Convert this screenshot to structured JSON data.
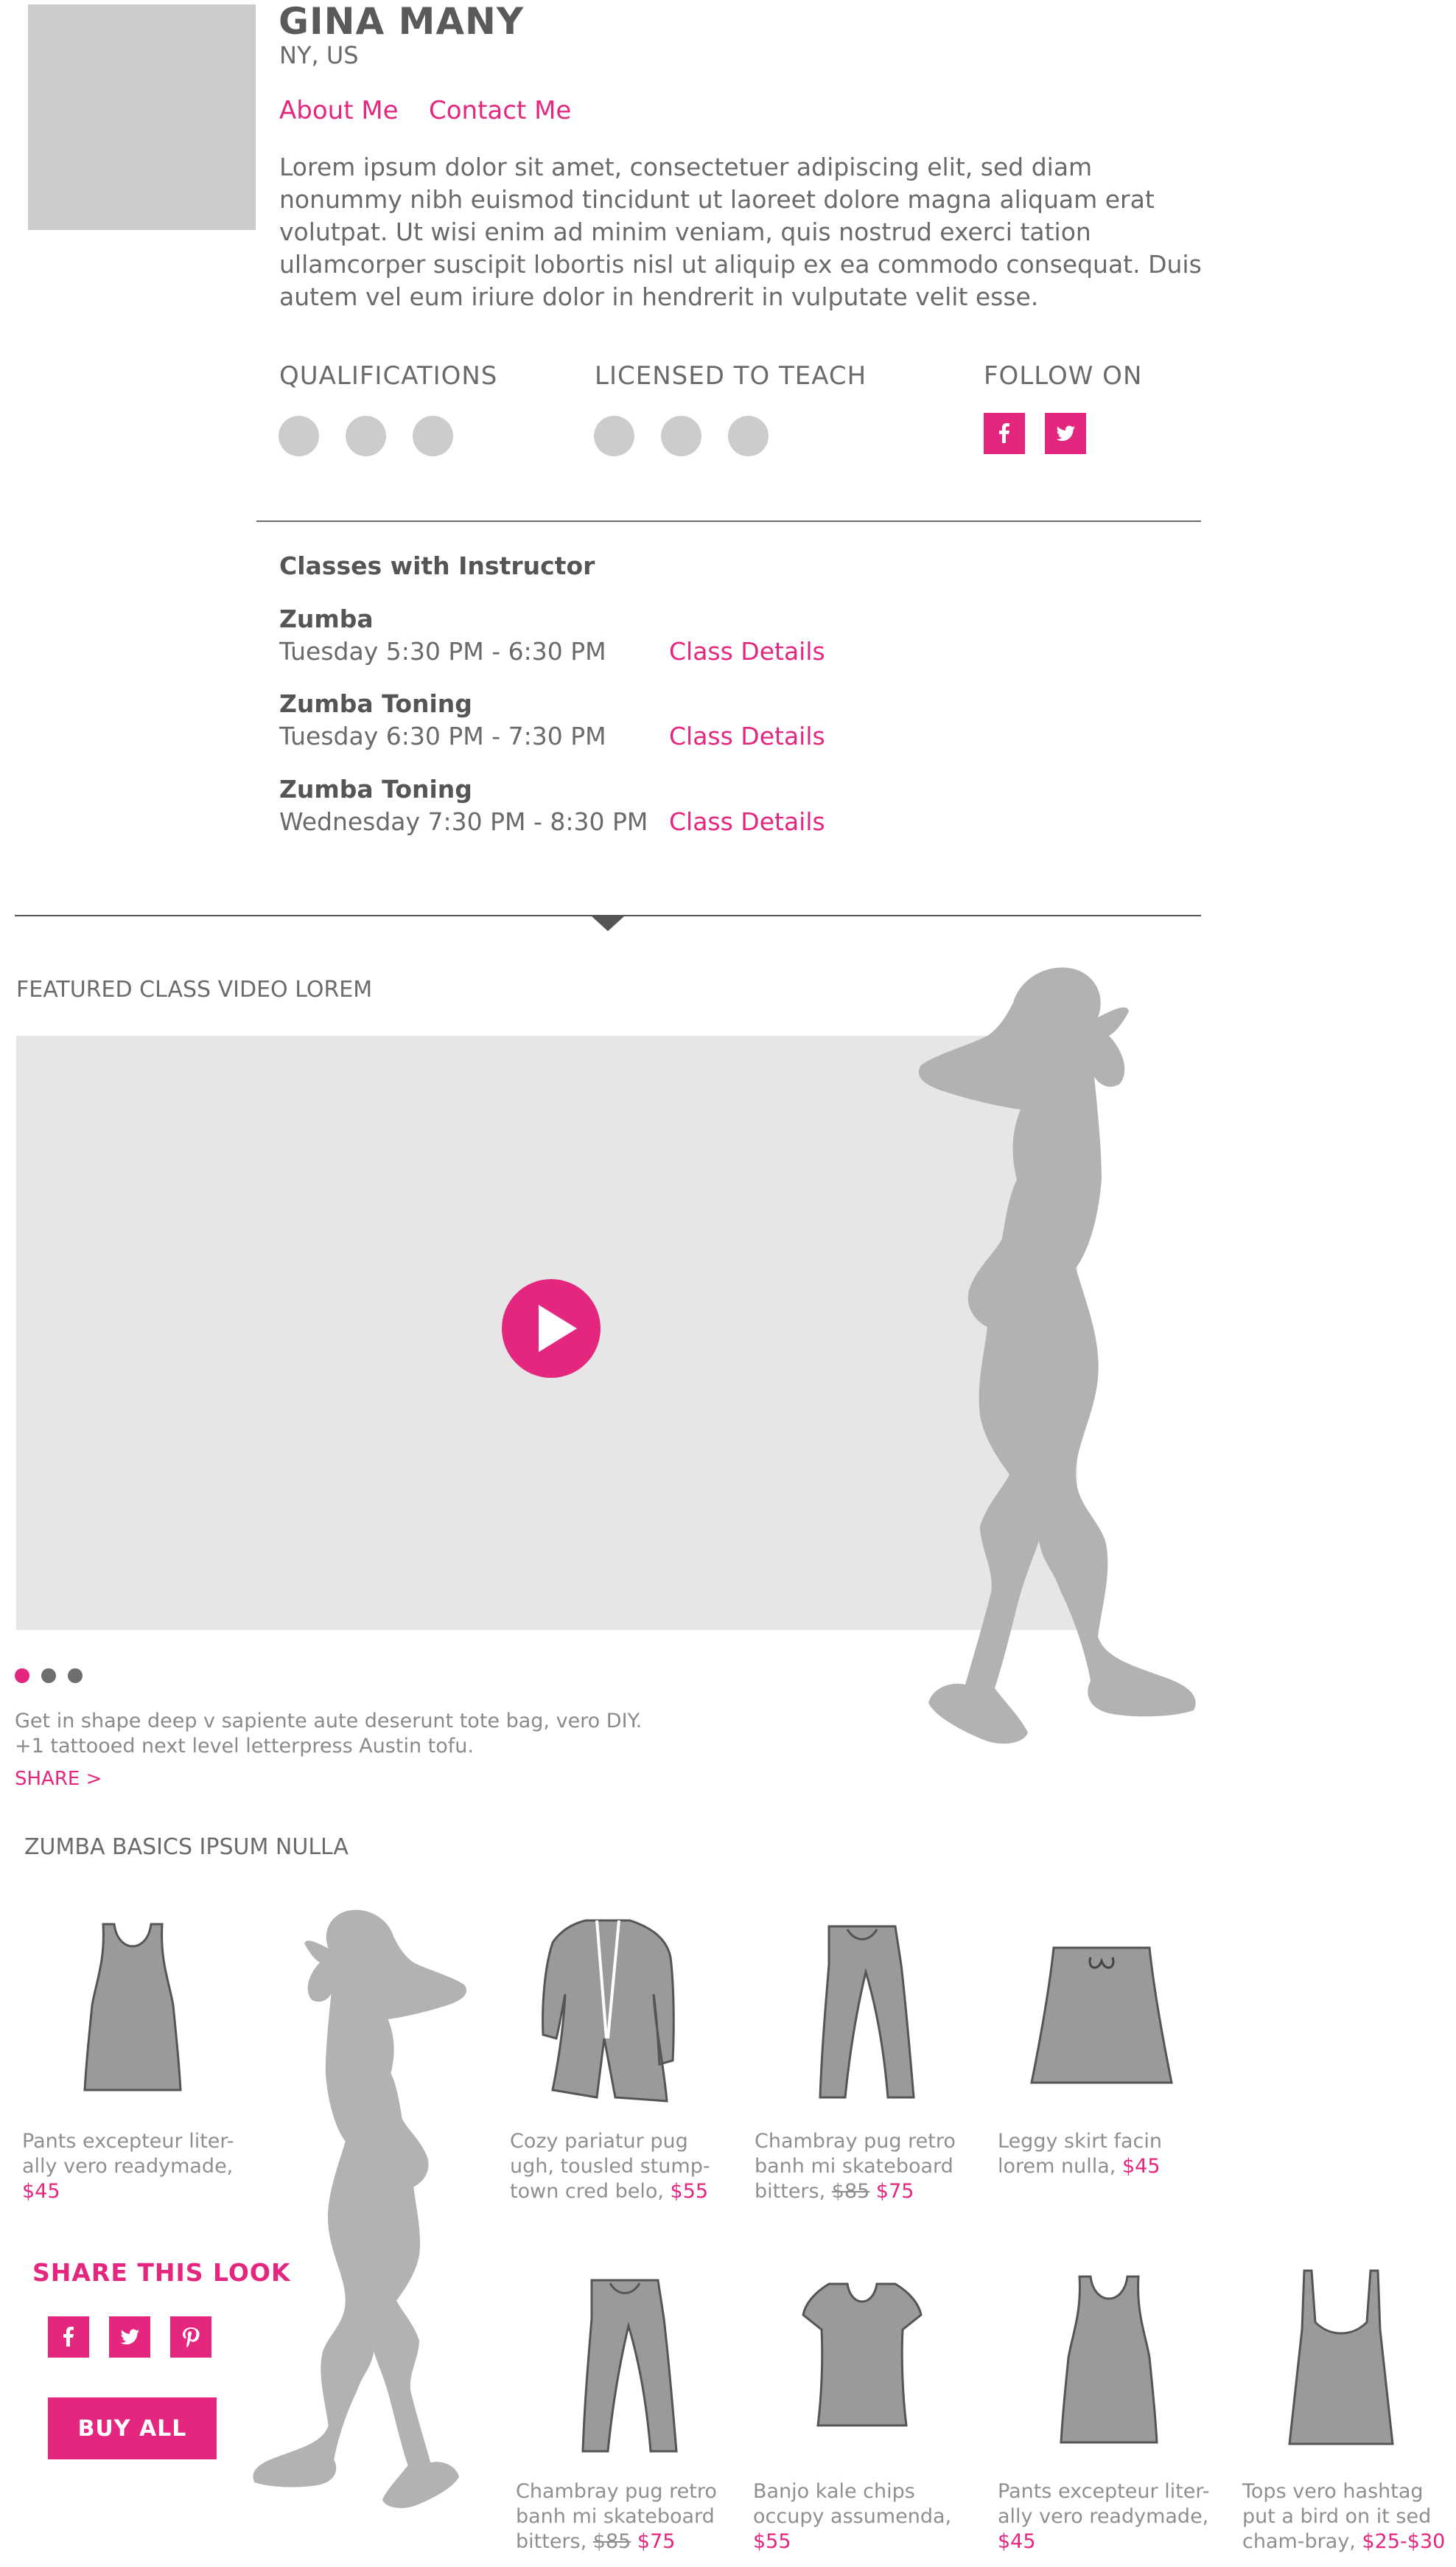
{
  "profile": {
    "name": "GINA MANY",
    "location": "NY, US",
    "about_label": "About Me",
    "contact_label": "Contact Me",
    "bio": "Lorem ipsum dolor sit amet, consectetuer adipiscing elit, sed diam nonummy nibh euismod tincidunt ut laoreet dolore magna aliquam erat volutpat. Ut wisi enim ad minim veniam, quis nostrud exerci tation ullamcorper suscipit lobortis nisl ut aliquip ex ea commodo consequat. Duis autem vel eum iriure dolor in hendrerit in vulputate velit esse.",
    "qualifications_label": "QUALIFICATIONS",
    "licensed_label": "LICENSED TO TEACH",
    "follow_label": "FOLLOW ON",
    "social": [
      "facebook-icon",
      "twitter-icon"
    ]
  },
  "classes": {
    "title": "Classes with Instructor",
    "link_label": "Class Details",
    "items": [
      {
        "name": "Zumba",
        "time": "Tuesday 5:30 PM - 6:30 PM"
      },
      {
        "name": "Zumba Toning",
        "time": "Tuesday 6:30 PM - 7:30 PM"
      },
      {
        "name": "Zumba Toning",
        "time": "Wednesday 7:30 PM - 8:30 PM"
      }
    ]
  },
  "featured": {
    "title": "FEATURED CLASS VIDEO LOREM",
    "description_1": "Get in shape deep v sapiente aute deserunt tote bag, vero DIY.",
    "description_2": "+1 tattooed next level letterpress Austin tofu.",
    "share_label": "SHARE >",
    "pager_count": 3,
    "pager_active": 0
  },
  "basics": {
    "title": "ZUMBA BASICS IPSUM NULLA",
    "share_look_label": "SHARE THIS LOOK",
    "buy_all_label": "BUY ALL",
    "share_icons": [
      "facebook-icon",
      "twitter-icon",
      "pinterest-icon"
    ],
    "products": [
      {
        "icon": "tank-top-icon",
        "text": "Pants excepteur liter-ally vero readymade,",
        "old_price": "",
        "price": "$45"
      },
      {
        "icon": "cardigan-icon",
        "text": "Cozy pariatur pug ugh, tousled stump-town cred belo,",
        "old_price": "",
        "price": "$55"
      },
      {
        "icon": "pants-icon",
        "text": "Chambray pug retro banh mi skateboard bitters,",
        "old_price": "$85",
        "price": "$75"
      },
      {
        "icon": "skirt-icon",
        "text": "Leggy skirt facin lorem nulla,",
        "old_price": "",
        "price": "$45"
      },
      {
        "icon": "pants-icon",
        "text": "Chambray pug retro banh mi skateboard bitters,",
        "old_price": "$85",
        "price": "$75"
      },
      {
        "icon": "tshirt-icon",
        "text": "Banjo kale chips occupy assumenda,",
        "old_price": "",
        "price": "$55"
      },
      {
        "icon": "tank-top-icon",
        "text": "Pants excepteur liter-ally vero readymade,",
        "old_price": "",
        "price": "$45"
      },
      {
        "icon": "camisole-icon",
        "text": "Tops vero hashtag put a bird on it sed cham-bray,",
        "old_price": "",
        "price": "$25-$30"
      }
    ]
  },
  "colors": {
    "accent": "#e5267f",
    "placeholder": "#cccccc",
    "video_bg": "#e6e6e6",
    "silhouette": "#b2b2b2",
    "garment": "#9a9a9c"
  }
}
